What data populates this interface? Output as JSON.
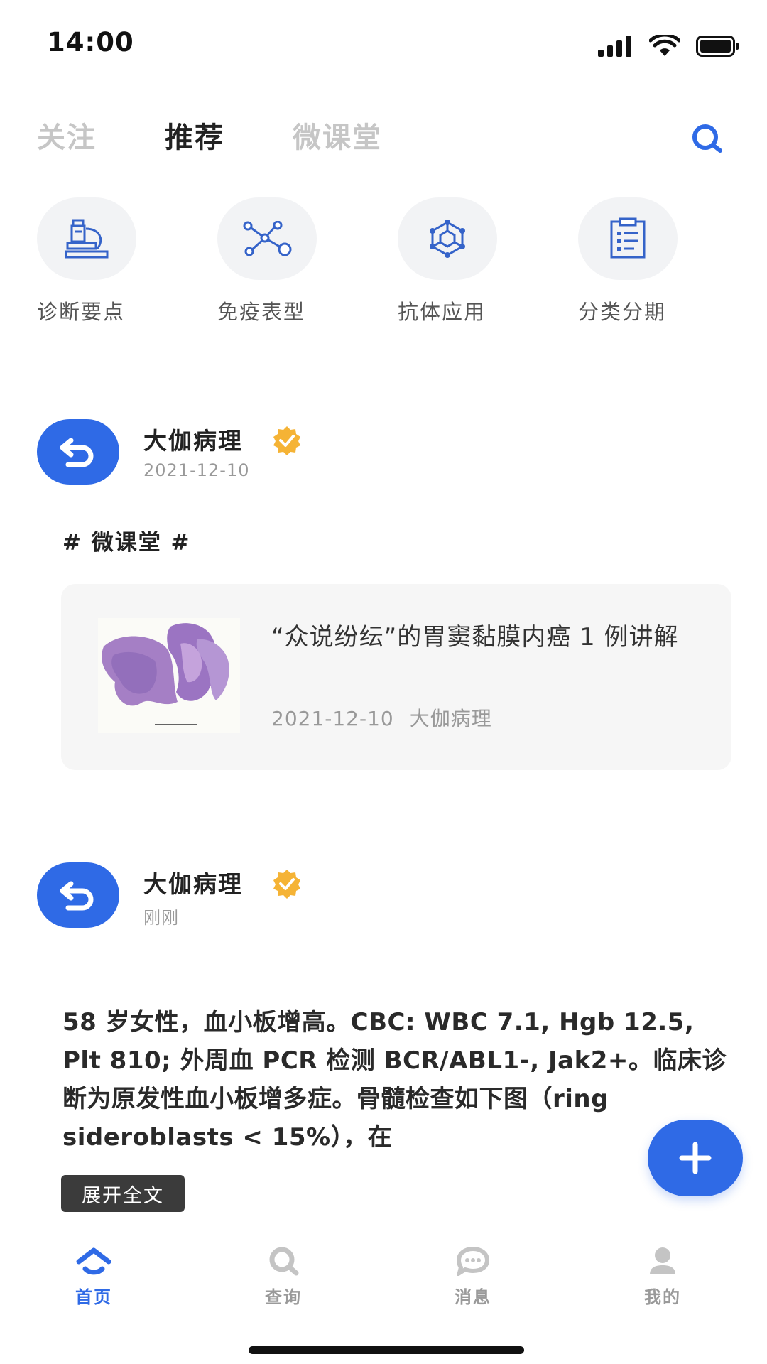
{
  "status_bar": {
    "time": "14:00"
  },
  "top_tabs": [
    {
      "label": "关注",
      "active": false
    },
    {
      "label": "推荐",
      "active": true
    },
    {
      "label": "微课堂",
      "active": false
    }
  ],
  "categories": [
    {
      "label": "诊断要点",
      "icon": "microscope-icon"
    },
    {
      "label": "免疫表型",
      "icon": "network-nodes-icon"
    },
    {
      "label": "抗体应用",
      "icon": "molecule-icon"
    },
    {
      "label": "分类分期",
      "icon": "clipboard-list-icon"
    }
  ],
  "posts": [
    {
      "author": "大伽病理",
      "date": "2021-12-10",
      "topic": "# 微课堂 #",
      "card": {
        "title": "“众说纷纭”的胃窦黏膜内癌 1 例讲解",
        "date": "2021-12-10",
        "source": "大伽病理"
      }
    },
    {
      "author": "大伽病理",
      "date": "刚刚",
      "body": "58 岁女性，血小板增高。CBC: WBC 7.1, Hgb 12.5, Plt 810; 外周血 PCR 检测 BCR/ABL1-, Jak2+。临床诊断为原发性血小板增多症。骨髓检查如下图（ring sideroblasts < 15%），在",
      "expand_label": "展开全文"
    }
  ],
  "bottom_nav": [
    {
      "label": "首页",
      "icon": "home-icon",
      "active": true
    },
    {
      "label": "查询",
      "icon": "search-icon",
      "active": false
    },
    {
      "label": "消息",
      "icon": "message-icon",
      "active": false
    },
    {
      "label": "我的",
      "icon": "profile-icon",
      "active": false
    }
  ],
  "colors": {
    "accent": "#2f6ae6",
    "badge": "#f5b335",
    "card_bg": "#f6f6f6"
  }
}
